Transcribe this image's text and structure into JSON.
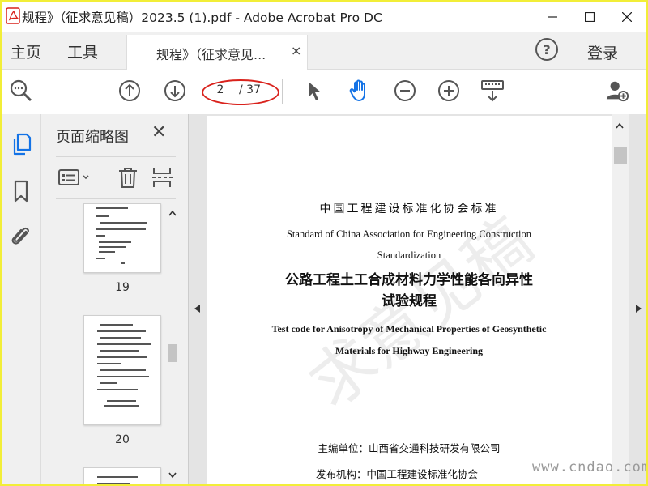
{
  "window": {
    "title": "规程》（征求意见稿）2023.5 (1).pdf - Adobe Acrobat Pro DC"
  },
  "nav": {
    "home": "主页",
    "tools": "工具",
    "doc_tab": "规程》（征求意见...",
    "doc_tab_close": "×",
    "help": "?",
    "login": "登录"
  },
  "toolbar": {
    "current_page": "2",
    "total_pages": "/ 37",
    "accent": "#1473e6",
    "highlight_oval": "#d9221c"
  },
  "panel": {
    "title": "页面缩略图",
    "close": "✕",
    "thumbnails": [
      {
        "page": "19"
      },
      {
        "page": "20"
      }
    ]
  },
  "document": {
    "line1": "中国工程建设标准化协会标准",
    "line2": "Standard of China Association for Engineering Construction",
    "line3": "Standardization",
    "line4": "公路工程土工合成材料力学性能各向异性",
    "line5": "试验规程",
    "line6": "Test code for Anisotropy of Mechanical Properties of Geosynthetic",
    "line7": "Materials for Highway Engineering",
    "line8": "主编单位：山西省交通科技研发有限公司",
    "line9": "发布机构：中国工程建设标准化协会"
  },
  "watermark": {
    "doc_watermark": "求意见稿",
    "site": "www.cndao.com"
  }
}
